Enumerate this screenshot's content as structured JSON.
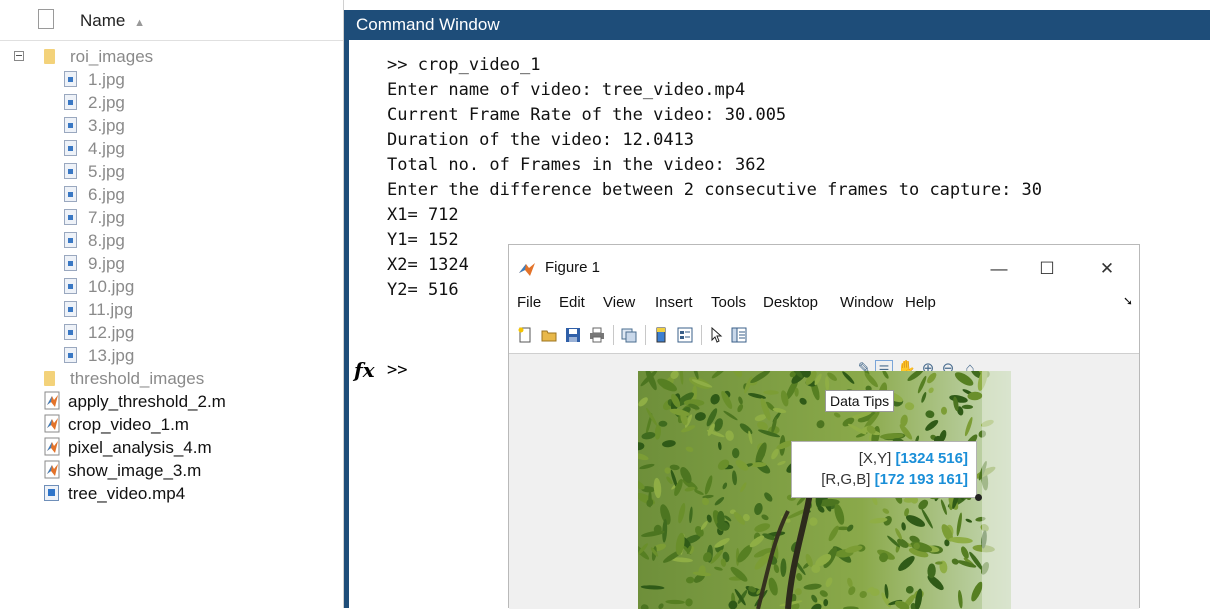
{
  "browser": {
    "header_label": "Name",
    "sort_indicator": "▲",
    "items": [
      {
        "label": "roi_images",
        "type": "folder",
        "expanded": true,
        "level": 0,
        "tone": "muted"
      },
      {
        "label": "1.jpg",
        "type": "jpg",
        "level": 1,
        "tone": "muted"
      },
      {
        "label": "2.jpg",
        "type": "jpg",
        "level": 1,
        "tone": "muted"
      },
      {
        "label": "3.jpg",
        "type": "jpg",
        "level": 1,
        "tone": "muted"
      },
      {
        "label": "4.jpg",
        "type": "jpg",
        "level": 1,
        "tone": "muted"
      },
      {
        "label": "5.jpg",
        "type": "jpg",
        "level": 1,
        "tone": "muted"
      },
      {
        "label": "6.jpg",
        "type": "jpg",
        "level": 1,
        "tone": "muted"
      },
      {
        "label": "7.jpg",
        "type": "jpg",
        "level": 1,
        "tone": "muted"
      },
      {
        "label": "8.jpg",
        "type": "jpg",
        "level": 1,
        "tone": "muted"
      },
      {
        "label": "9.jpg",
        "type": "jpg",
        "level": 1,
        "tone": "muted"
      },
      {
        "label": "10.jpg",
        "type": "jpg",
        "level": 1,
        "tone": "muted"
      },
      {
        "label": "11.jpg",
        "type": "jpg",
        "level": 1,
        "tone": "muted"
      },
      {
        "label": "12.jpg",
        "type": "jpg",
        "level": 1,
        "tone": "muted"
      },
      {
        "label": "13.jpg",
        "type": "jpg",
        "level": 1,
        "tone": "muted"
      },
      {
        "label": "threshold_images",
        "type": "folder",
        "expanded": false,
        "level": 0,
        "tone": "muted"
      },
      {
        "label": "apply_threshold_2.m",
        "type": "m",
        "level": 0,
        "tone": "dark"
      },
      {
        "label": "crop_video_1.m",
        "type": "m",
        "level": 0,
        "tone": "dark"
      },
      {
        "label": "pixel_analysis_4.m",
        "type": "m",
        "level": 0,
        "tone": "dark"
      },
      {
        "label": "show_image_3.m",
        "type": "m",
        "level": 0,
        "tone": "dark"
      },
      {
        "label": "tree_video.mp4",
        "type": "mp4",
        "level": 0,
        "tone": "dark"
      }
    ]
  },
  "command_window": {
    "title": "Command Window",
    "lines": [
      ">> crop_video_1",
      "Enter name of video: tree_video.mp4",
      "Current Frame Rate of the video: 30.005",
      "Duration of the video: 12.0413",
      "Total no. of Frames in the video: 362",
      "Enter the difference between 2 consecutive frames to capture: 30",
      "X1= 712",
      "Y1= 152",
      "X2= 1324",
      "Y2= 516"
    ],
    "prompt": ">>",
    "fx_label": "fx"
  },
  "figure": {
    "title": "Figure 1",
    "minimize_glyph": "—",
    "maximize_glyph": "☐",
    "close_glyph": "✕",
    "menu": [
      "File",
      "Edit",
      "View",
      "Insert",
      "Tools",
      "Desktop",
      "Window",
      "Help"
    ],
    "menu_arrow": "➘",
    "toolbar_icons": [
      "new-file-icon",
      "open-folder-icon",
      "save-icon",
      "print-icon",
      "link-plot-icon",
      "colorbar-icon",
      "legend-icon",
      "pointer-icon",
      "property-inspector-icon"
    ],
    "axes_toolbar_icons": [
      "brush-icon",
      "data-tips-icon",
      "pan-icon",
      "zoom-in-icon",
      "zoom-out-icon",
      "home-icon"
    ],
    "tooltip": "Data Tips",
    "datatip": {
      "xy_label": "[X,Y]",
      "xy_value": "[1324 516]",
      "rgb_label": "[R,G,B]",
      "rgb_value": "[172 193 161]"
    }
  },
  "colors": {
    "title_bar": "#1e4d79",
    "datatip_value": "#1a8fd8",
    "folder": "#f3d27a"
  }
}
